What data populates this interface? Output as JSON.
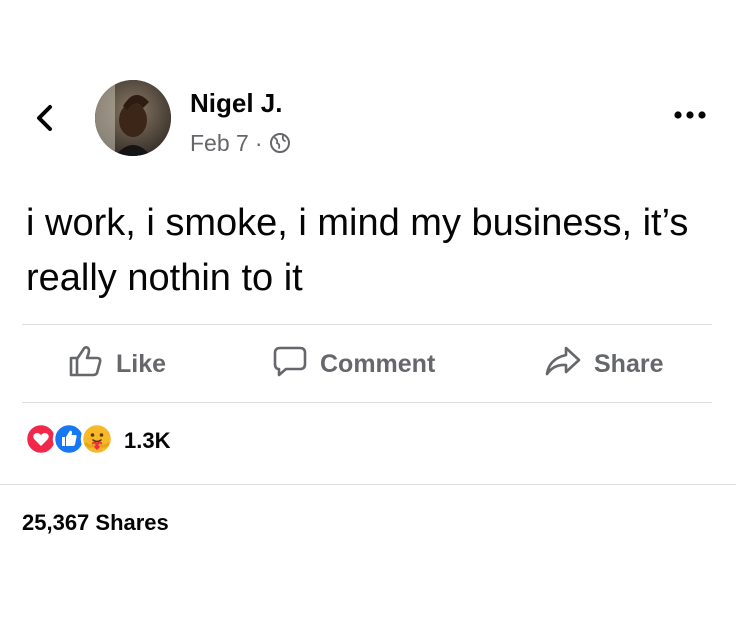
{
  "header": {
    "back_icon": "chevron-left-icon",
    "author_name": "Nigel J.",
    "date": "Feb 7",
    "separator": "·",
    "privacy_icon": "globe-icon",
    "more_icon": "ellipsis-icon"
  },
  "post": {
    "text": "i work, i smoke, i mind my business, it’s really nothin to it"
  },
  "actions": {
    "like_label": "Like",
    "comment_label": "Comment",
    "share_label": "Share"
  },
  "reactions": {
    "icons": [
      "love-reaction-icon",
      "like-reaction-icon",
      "care-reaction-icon"
    ],
    "count": "1.3K"
  },
  "shares": {
    "label": "25,367 Shares"
  },
  "colors": {
    "text": "#050505",
    "muted": "#65676b",
    "divider": "#dcdde1",
    "like_blue": "#1877f2",
    "love_red": "#f0284a",
    "care_yellow": "#f7b928"
  }
}
